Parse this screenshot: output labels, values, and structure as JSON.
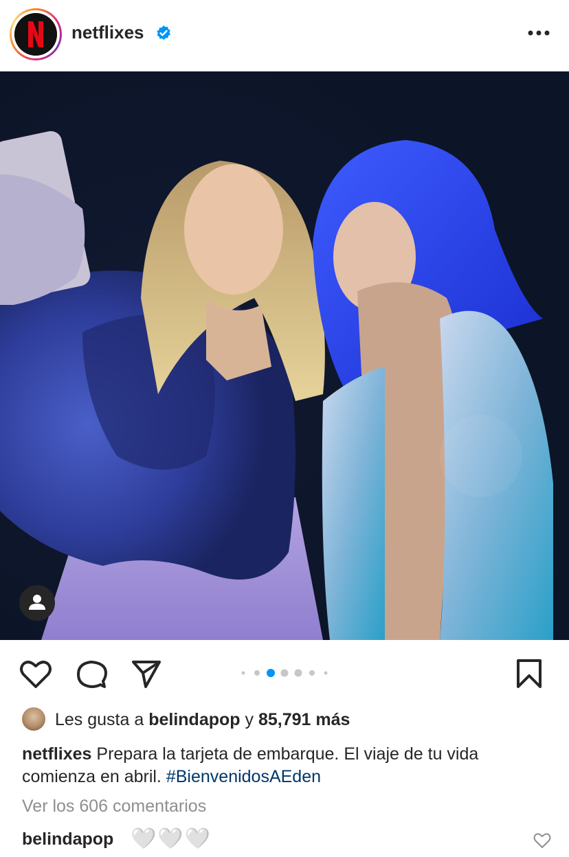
{
  "post": {
    "username": "netflixes",
    "verified": true,
    "avatar_letter": "N",
    "brand_color": "#e50914",
    "more_icon": "more-horizontal-icon"
  },
  "media": {
    "carousel_count": 6,
    "carousel_active_index": 2,
    "accent_color": "#0095f6",
    "tag_icon": "user-tag-icon"
  },
  "actions": {
    "like_icon": "heart-icon",
    "comment_icon": "comment-icon",
    "share_icon": "send-icon",
    "save_icon": "bookmark-icon"
  },
  "likes": {
    "prefix": "Les gusta a",
    "user": "belindapop",
    "middle": "y",
    "count": "85,791 más"
  },
  "caption": {
    "user": "netflixes",
    "text": "Prepara la tarjeta de embarque. El viaje de tu vida comienza en abril.",
    "hashtag": "#BienvenidosAEden"
  },
  "comments": {
    "view_all": "Ver los 606 comentarios",
    "top": {
      "user": "belindapop",
      "text": "🤍🤍🤍"
    }
  }
}
